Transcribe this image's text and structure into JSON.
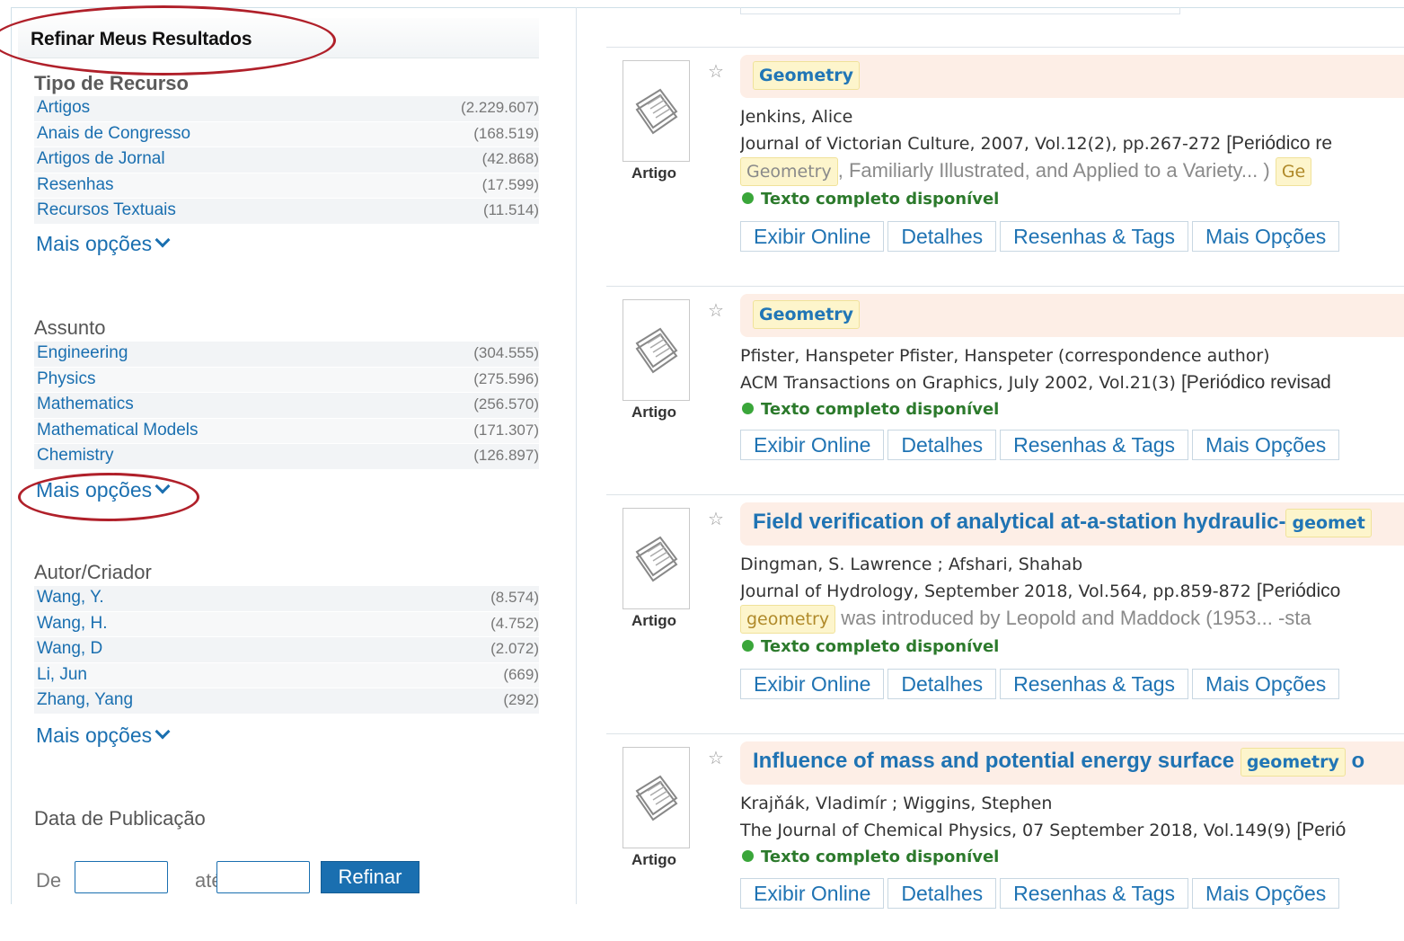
{
  "sidebar": {
    "title": "Refinar Meus Resultados",
    "facets": [
      {
        "title": "Tipo de Recurso",
        "items": [
          {
            "label": "Artigos",
            "count": "(2.229.607)"
          },
          {
            "label": "Anais de Congresso",
            "count": "(168.519)"
          },
          {
            "label": "Artigos de Jornal",
            "count": "(42.868)"
          },
          {
            "label": "Resenhas",
            "count": "(17.599)"
          },
          {
            "label": "Recursos Textuais",
            "count": "(11.514)"
          }
        ],
        "more": "Mais opções"
      },
      {
        "title": "Assunto",
        "items": [
          {
            "label": "Engineering",
            "count": "(304.555)"
          },
          {
            "label": "Physics",
            "count": "(275.596)"
          },
          {
            "label": "Mathematics",
            "count": "(256.570)"
          },
          {
            "label": "Mathematical Models",
            "count": "(171.307)"
          },
          {
            "label": "Chemistry",
            "count": "(126.897)"
          }
        ],
        "more": "Mais opções"
      },
      {
        "title": "Autor/Criador",
        "items": [
          {
            "label": "Wang, Y.",
            "count": "(8.574)"
          },
          {
            "label": "Wang, H.",
            "count": "(4.752)"
          },
          {
            "label": "Wang, D",
            "count": "(2.072)"
          },
          {
            "label": "Li, Jun",
            "count": "(669)"
          },
          {
            "label": "Zhang, Yang",
            "count": "(292)"
          }
        ],
        "more": "Mais opções"
      }
    ],
    "date": {
      "title": "Data de Publicação",
      "from_label": "De",
      "to_label": "até",
      "from_value": "",
      "to_value": "",
      "button": "Refinar"
    }
  },
  "results": [
    {
      "type": "Artigo",
      "title": "",
      "title_hl": "Geometry",
      "title_after": "",
      "authors": "Jenkins, Alice",
      "source": "Journal of Victorian Culture, 2007, Vol.12(2), pp.267-272",
      "source_tag": "[Periódico re",
      "snippet_hl": "Geometry",
      "snippet": ", Familiarly Illustrated, and Applied to a Variety... )",
      "snippet_hl2": "Ge",
      "availability": "Texto completo disponível"
    },
    {
      "type": "Artigo",
      "title": "",
      "title_hl": "Geometry",
      "title_after": "",
      "authors": "Pfister, Hanspeter Pfister, Hanspeter (correspondence author)",
      "source": "ACM Transactions on Graphics, July 2002, Vol.21(3)",
      "source_tag": "[Periódico revisad",
      "snippet_hl": "",
      "snippet": "",
      "snippet_hl2": "",
      "availability": "Texto completo disponível"
    },
    {
      "type": "Artigo",
      "title": "Field verification of analytical at-a-station hydraulic-",
      "title_hl": "geomet",
      "title_after": "",
      "authors": "Dingman, S. Lawrence ; Afshari, Shahab",
      "source": "Journal of Hydrology, September 2018, Vol.564, pp.859-872",
      "source_tag": "[Periódico",
      "snippet_hl": "geometry",
      "snippet": " was introduced by Leopold and Maddock (1953... -sta",
      "snippet_hl2": "",
      "availability": "Texto completo disponível"
    },
    {
      "type": "Artigo",
      "title": "Influence of mass and potential energy surface ",
      "title_hl": "geometry",
      "title_after": " o",
      "authors": "Krajňák, Vladimír ; Wiggins, Stephen",
      "source": "The Journal of Chemical Physics, 07 September 2018, Vol.149(9)",
      "source_tag": "[Perió",
      "snippet_hl": "",
      "snippet": "",
      "snippet_hl2": "",
      "availability": "Texto completo disponível"
    }
  ],
  "actions": [
    "Exibir Online",
    "Detalhes",
    "Resenhas & Tags",
    "Mais Opções"
  ],
  "colors": {
    "link": "#1a6fb0",
    "title_bg": "#fdeee6",
    "highlight_bg": "#fdf5cc",
    "available": "#3aa63a",
    "annotation_oval": "#b0202a"
  },
  "icons": {
    "favorite": "star-outline-icon",
    "document": "document-icon",
    "available": "green-dot-icon",
    "expand": "chevron-down-icon"
  }
}
